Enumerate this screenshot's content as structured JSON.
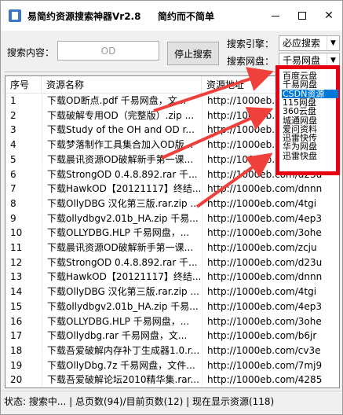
{
  "window": {
    "title": "易简约资源搜索神器Vr2.8",
    "slogan": "简约而不简单",
    "minimize_label": "",
    "maximize_label": "",
    "close_label": "✕"
  },
  "toolbar": {
    "search_label": "搜索内容：",
    "search_value": "OD",
    "stop_label": "停止搜索",
    "engine_label": "搜索引擎：",
    "engine_value": "必应搜索",
    "netdisk_label": "搜索网盘：",
    "netdisk_value": "千易网盘"
  },
  "list": {
    "columns": [
      "序号",
      "资源名称",
      "资源地址"
    ],
    "rows": [
      {
        "idx": "1",
        "name": "下载OD断点.pdf  千易网盘，文...",
        "url": "http://1000eb.com/8d4q"
      },
      {
        "idx": "2",
        "name": "下载破解专用OD（完整版）.zip ...",
        "url": "http://1000eb.com/8ovd"
      },
      {
        "idx": "3",
        "name": "下载Study of the OH and OD r...",
        "url": "http://1000eb.com/4fkt"
      },
      {
        "idx": "4",
        "name": "下载梦落制作工具集合加入OD版...",
        "url": "http://1000eb.com/3tq1"
      },
      {
        "idx": "5",
        "name": "下载晨讯资源OD破解新手第一课...",
        "url": "http://1000eb.com/zcju"
      },
      {
        "idx": "6",
        "name": "下载StrongOD 0.4.8.892.rar  千...",
        "url": "http://1000eb.com/d23u"
      },
      {
        "idx": "7",
        "name": "下载HawkOD【20121117】终结...",
        "url": "http://1000eb.com/dnnn"
      },
      {
        "idx": "8",
        "name": "下载OllyDBG 汉化第三版.rar.zip ...",
        "url": "http://1000eb.com/4tgi"
      },
      {
        "idx": "9",
        "name": "下载ollydbgv2.01b_HA.zip  千易...",
        "url": "http://1000eb.com/4ep3"
      },
      {
        "idx": "10",
        "name": "下载OLLYDBG.HLP  千易网盘，...",
        "url": "http://1000eb.com/3ohe"
      },
      {
        "idx": "11",
        "name": "下载晨讯资源OD破解新手第一课...",
        "url": "http://1000eb.com/zcju"
      },
      {
        "idx": "12",
        "name": "下载StrongOD 0.4.8.892.rar  千...",
        "url": "http://1000eb.com/d23u"
      },
      {
        "idx": "13",
        "name": "下载HawkOD【20121117】终结...",
        "url": "http://1000eb.com/dnnn"
      },
      {
        "idx": "14",
        "name": "下载OllyDBG 汉化第三版.rar.zip ...",
        "url": "http://1000eb.com/4tgi"
      },
      {
        "idx": "15",
        "name": "下载ollydbgv2.01b_HA.zip  千易...",
        "url": "http://1000eb.com/4ep3"
      },
      {
        "idx": "16",
        "name": "下载OLLYDBG.HLP  千易网盘，...",
        "url": "http://1000eb.com/3ohe"
      },
      {
        "idx": "17",
        "name": "下载Ollydbg.rar  千易网盘，文...",
        "url": "http://1000eb.com/b6jr"
      },
      {
        "idx": "18",
        "name": "下载吾爱破解内存补丁生成器1.0.r...",
        "url": "http://1000eb.com/cv3e"
      },
      {
        "idx": "19",
        "name": "下载OllyDbg.7z  千易网盘，文件...",
        "url": "http://1000eb.com/7mj9"
      },
      {
        "idx": "20",
        "name": "下载吾爱破解论坛2010精华集.rar...",
        "url": "http://1000eb.com/4285"
      }
    ]
  },
  "status": {
    "text": "状态: 搜索中... | 总页数(94)/目前页数(12) | 现在显示资源(118)"
  },
  "dropdown": {
    "options": [
      "百度云盘",
      "千易网盘",
      "CSDN资源",
      "115网盘",
      "360云盘",
      "城通网盘",
      "爱问资料",
      "迅雷快传",
      "华为网盘",
      "迅雷快盘"
    ],
    "selected_index": 2
  },
  "colors": {
    "highlight_border": "#e60012",
    "arrow": "#f0403c",
    "selection": "#0078d7"
  }
}
